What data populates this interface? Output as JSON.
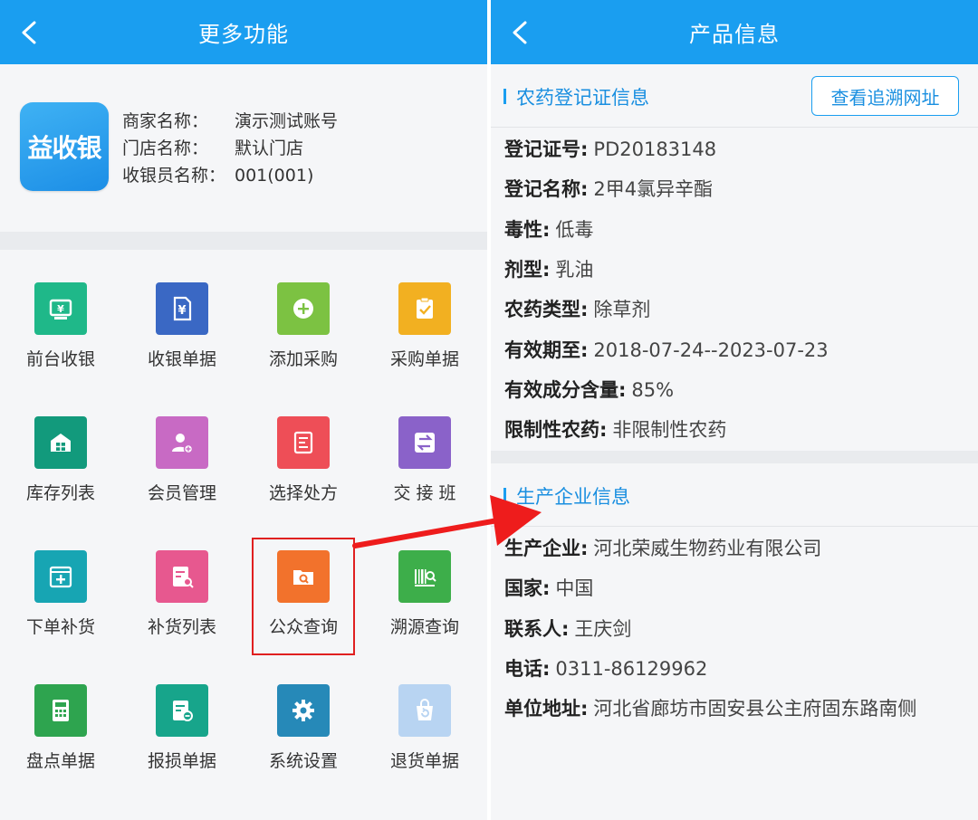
{
  "left": {
    "title": "更多功能",
    "logo_text": "益收银",
    "merchant": [
      {
        "label": "商家名称：",
        "value": "演示测试账号"
      },
      {
        "label": "门店名称：",
        "value": "默认门店"
      },
      {
        "label": "收银员名称：",
        "value": "001(001)"
      }
    ],
    "grid": [
      {
        "label": "前台收银",
        "icon": "cashier-icon",
        "color": "#1fb889"
      },
      {
        "label": "收银单据",
        "icon": "yen-receipt-icon",
        "color": "#3a68c4"
      },
      {
        "label": "添加采购",
        "icon": "plus-circle-icon",
        "color": "#7cc242"
      },
      {
        "label": "采购单据",
        "icon": "clipboard-check-icon",
        "color": "#f2b021"
      },
      {
        "label": "库存列表",
        "icon": "warehouse-icon",
        "color": "#129a7c"
      },
      {
        "label": "会员管理",
        "icon": "member-icon",
        "color": "#c86ac4"
      },
      {
        "label": "选择处方",
        "icon": "prescription-icon",
        "color": "#ee4e57"
      },
      {
        "label": "交 接 班",
        "icon": "swap-icon",
        "color": "#8a62c9"
      },
      {
        "label": "下单补货",
        "icon": "restock-icon",
        "color": "#17a5b3"
      },
      {
        "label": "补货列表",
        "icon": "list-search-icon",
        "color": "#e7588f"
      },
      {
        "label": "公众查询",
        "icon": "folder-search-icon",
        "color": "#f2722c"
      },
      {
        "label": "溯源查询",
        "icon": "barcode-search-icon",
        "color": "#3dae4a"
      },
      {
        "label": "盘点单据",
        "icon": "calculator-icon",
        "color": "#2ea44f"
      },
      {
        "label": "报损单据",
        "icon": "loss-report-icon",
        "color": "#17a58b"
      },
      {
        "label": "系统设置",
        "icon": "gear-icon",
        "color": "#2689b8"
      },
      {
        "label": "退货单据",
        "icon": "return-bag-icon",
        "color": "#b8d4f2"
      }
    ]
  },
  "right": {
    "title": "产品信息",
    "section1": {
      "title": "农药登记证信息",
      "button": "查看追溯网址",
      "rows": [
        {
          "k": "登记证号:",
          "v": "PD20183148"
        },
        {
          "k": "登记名称:",
          "v": "2甲4氯异辛酯"
        },
        {
          "k": "毒性:",
          "v": "低毒"
        },
        {
          "k": "剂型:",
          "v": "乳油"
        },
        {
          "k": "农药类型:",
          "v": "除草剂"
        },
        {
          "k": "有效期至:",
          "v": "2018-07-24--2023-07-23"
        },
        {
          "k": "有效成分含量:",
          "v": "85%"
        },
        {
          "k": "限制性农药:",
          "v": "非限制性农药"
        }
      ]
    },
    "section2": {
      "title": "生产企业信息",
      "rows": [
        {
          "k": "生产企业:",
          "v": "河北荣威生物药业有限公司"
        },
        {
          "k": "国家:",
          "v": "中国"
        },
        {
          "k": "联系人:",
          "v": "王庆剑"
        },
        {
          "k": "电话:",
          "v": "0311-86129962"
        },
        {
          "k": "单位地址:",
          "v": "河北省廊坊市固安县公主府固东路南侧"
        }
      ]
    }
  },
  "colors": {
    "primary": "#1a9ef0",
    "highlight": "#e02020"
  }
}
